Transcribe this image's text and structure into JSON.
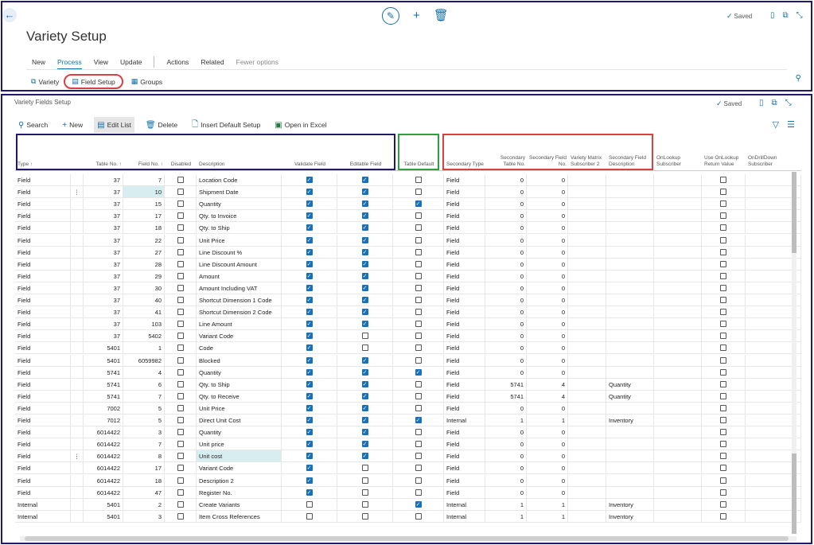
{
  "header": {
    "title": "Variety Setup",
    "saved": "Saved",
    "menu": [
      "New",
      "Process",
      "View",
      "Update"
    ],
    "menu2": [
      "Actions",
      "Related",
      "Fewer options"
    ],
    "actions": [
      "Variety",
      "Field Setup",
      "Groups"
    ]
  },
  "part": {
    "title": "Variety Fields Setup",
    "saved": "Saved",
    "toolbar": [
      "Search",
      "New",
      "Edit List",
      "Delete",
      "Insert Default Setup",
      "Open in Excel"
    ]
  },
  "columns": [
    {
      "key": "type",
      "label": "Type ↑"
    },
    {
      "key": "drag",
      "label": ""
    },
    {
      "key": "table",
      "label": "Table No. ↑"
    },
    {
      "key": "field",
      "label": "Field No. ↑"
    },
    {
      "key": "disabled",
      "label": "Disabled"
    },
    {
      "key": "desc",
      "label": "Description"
    },
    {
      "key": "validate",
      "label": "Validate Field"
    },
    {
      "key": "editable",
      "label": "Editable Field"
    },
    {
      "key": "tabledefault",
      "label": "Table Default"
    },
    {
      "key": "sectype",
      "label": "Secondary Type"
    },
    {
      "key": "sectable",
      "label": "Secondary Table No."
    },
    {
      "key": "secfield",
      "label": "Secondary Field No."
    },
    {
      "key": "vms2",
      "label": "Variety Matrix Subscriber 2"
    },
    {
      "key": "secdesc",
      "label": "Secondary Field Description"
    },
    {
      "key": "onlookup",
      "label": "OnLookup Subscriber"
    },
    {
      "key": "useonlookup",
      "label": "Use OnLookup Return Value"
    },
    {
      "key": "ondrill",
      "label": "OnDrillDown Subscriber"
    }
  ],
  "rows": [
    [
      "Field",
      "37",
      "7",
      false,
      "Location Code",
      true,
      true,
      false,
      "Field",
      "0",
      "0",
      "",
      ""
    ],
    [
      "Field",
      "37",
      "10",
      false,
      "Shipment Date",
      true,
      true,
      false,
      "Field",
      "0",
      "0",
      "",
      ""
    ],
    [
      "Field",
      "37",
      "15",
      false,
      "Quantity",
      true,
      true,
      true,
      "Field",
      "0",
      "0",
      "",
      ""
    ],
    [
      "Field",
      "37",
      "17",
      false,
      "Qty. to Invoice",
      true,
      true,
      false,
      "Field",
      "0",
      "0",
      "",
      ""
    ],
    [
      "Field",
      "37",
      "18",
      false,
      "Qty. to Ship",
      true,
      true,
      false,
      "Field",
      "0",
      "0",
      "",
      ""
    ],
    [
      "Field",
      "37",
      "22",
      false,
      "Unit Price",
      true,
      true,
      false,
      "Field",
      "0",
      "0",
      "",
      ""
    ],
    [
      "Field",
      "37",
      "27",
      false,
      "Line Discount %",
      true,
      true,
      false,
      "Field",
      "0",
      "0",
      "",
      ""
    ],
    [
      "Field",
      "37",
      "28",
      false,
      "Line Discount Amount",
      true,
      true,
      false,
      "Field",
      "0",
      "0",
      "",
      ""
    ],
    [
      "Field",
      "37",
      "29",
      false,
      "Amount",
      true,
      true,
      false,
      "Field",
      "0",
      "0",
      "",
      ""
    ],
    [
      "Field",
      "37",
      "30",
      false,
      "Amount Including VAT",
      true,
      true,
      false,
      "Field",
      "0",
      "0",
      "",
      ""
    ],
    [
      "Field",
      "37",
      "40",
      false,
      "Shortcut Dimension 1 Code",
      true,
      true,
      false,
      "Field",
      "0",
      "0",
      "",
      ""
    ],
    [
      "Field",
      "37",
      "41",
      false,
      "Shortcut Dimension 2 Code",
      true,
      true,
      false,
      "Field",
      "0",
      "0",
      "",
      ""
    ],
    [
      "Field",
      "37",
      "103",
      false,
      "Line Amount",
      true,
      true,
      false,
      "Field",
      "0",
      "0",
      "",
      ""
    ],
    [
      "Field",
      "37",
      "5402",
      false,
      "Variant Code",
      true,
      false,
      false,
      "Field",
      "0",
      "0",
      "",
      ""
    ],
    [
      "Field",
      "5401",
      "1",
      false,
      "Code",
      true,
      false,
      false,
      "Field",
      "0",
      "0",
      "",
      ""
    ],
    [
      "Field",
      "5401",
      "6059982",
      false,
      "Blocked",
      true,
      true,
      false,
      "Field",
      "0",
      "0",
      "",
      ""
    ],
    [
      "Field",
      "5741",
      "4",
      false,
      "Quantity",
      true,
      true,
      true,
      "Field",
      "0",
      "0",
      "",
      ""
    ],
    [
      "Field",
      "5741",
      "6",
      false,
      "Qty. to Ship",
      true,
      true,
      false,
      "Field",
      "5741",
      "4",
      "Quantity",
      ""
    ],
    [
      "Field",
      "5741",
      "7",
      false,
      "Qty. to Receive",
      true,
      true,
      false,
      "Field",
      "5741",
      "4",
      "Quantity",
      ""
    ],
    [
      "Field",
      "7002",
      "5",
      false,
      "Unit Price",
      true,
      true,
      false,
      "Field",
      "0",
      "0",
      "",
      ""
    ],
    [
      "Field",
      "7012",
      "5",
      false,
      "Direct Unit Cost",
      true,
      true,
      true,
      "Internal",
      "1",
      "1",
      "Inventory",
      ""
    ],
    [
      "Field",
      "6014422",
      "3",
      false,
      "Quantity",
      true,
      true,
      false,
      "Field",
      "0",
      "0",
      "",
      ""
    ],
    [
      "Field",
      "6014422",
      "7",
      false,
      "Unit price",
      true,
      true,
      false,
      "Field",
      "0",
      "0",
      "",
      ""
    ],
    [
      "Field",
      "6014422",
      "8",
      false,
      "Unit cost",
      true,
      true,
      false,
      "Field",
      "0",
      "0",
      "",
      ""
    ],
    [
      "Field",
      "6014422",
      "17",
      false,
      "Variant Code",
      true,
      false,
      false,
      "Field",
      "0",
      "0",
      "",
      ""
    ],
    [
      "Field",
      "6014422",
      "18",
      false,
      "Description 2",
      true,
      false,
      false,
      "Field",
      "0",
      "0",
      "",
      ""
    ],
    [
      "Field",
      "6014422",
      "47",
      false,
      "Register No.",
      true,
      false,
      false,
      "Field",
      "0",
      "0",
      "",
      ""
    ],
    [
      "Internal",
      "5401",
      "2",
      false,
      "Create Variants",
      false,
      false,
      true,
      "Internal",
      "1",
      "1",
      "Inventory",
      ""
    ],
    [
      "Internal",
      "5401",
      "3",
      false,
      "Item Cross References",
      false,
      false,
      false,
      "Internal",
      "1",
      "1",
      "Inventory",
      ""
    ]
  ]
}
